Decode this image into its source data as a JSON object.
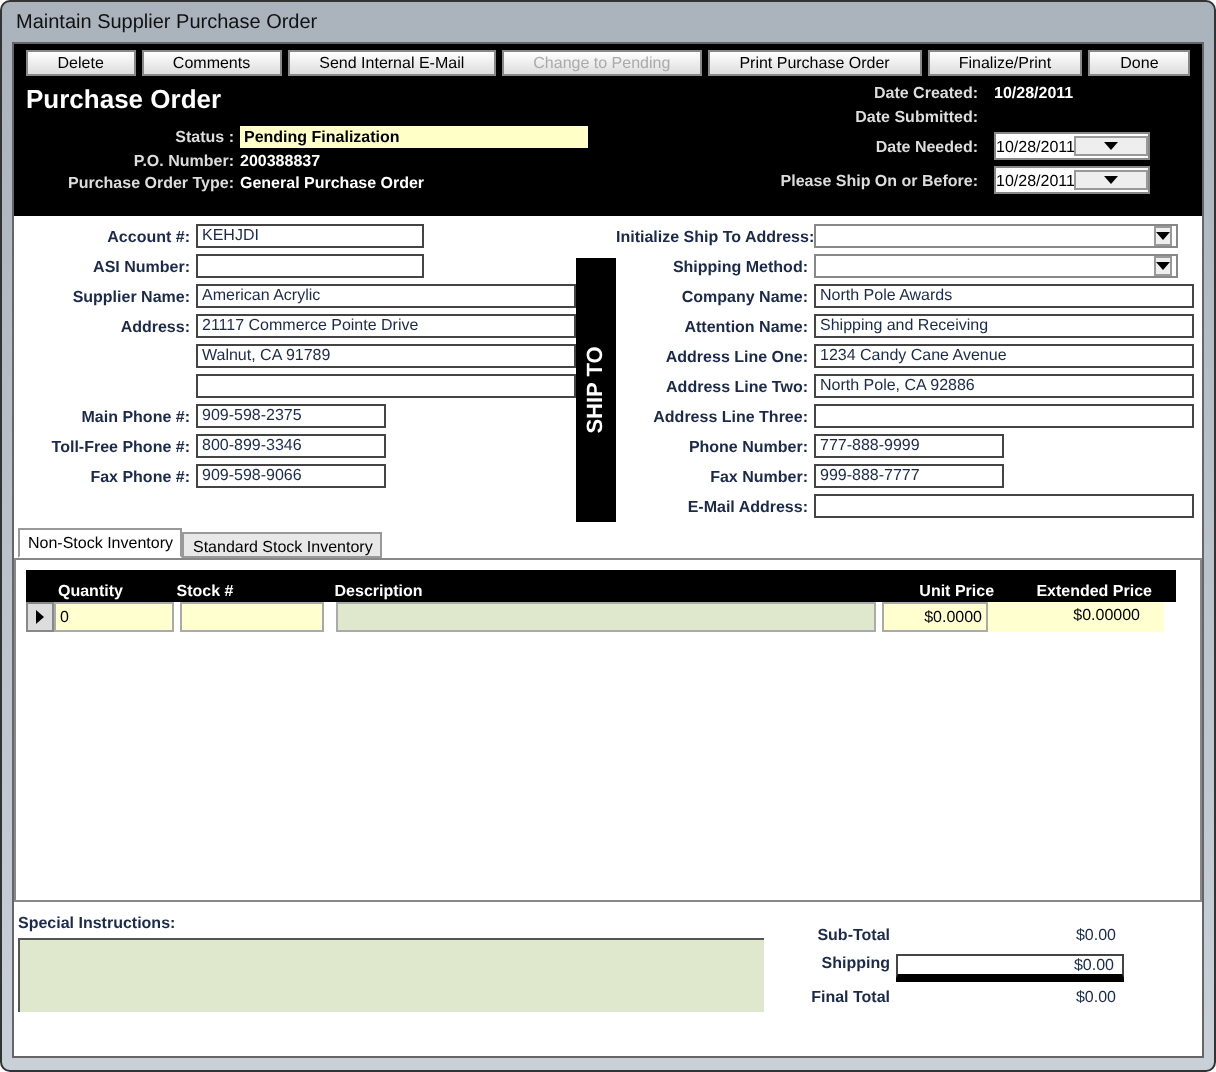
{
  "window": {
    "title": "Maintain Supplier Purchase Order"
  },
  "toolbar": [
    {
      "label": "Delete",
      "disabled": false
    },
    {
      "label": "Comments",
      "disabled": false
    },
    {
      "label": "Send Internal E-Mail",
      "disabled": false
    },
    {
      "label": "Change to Pending",
      "disabled": true
    },
    {
      "label": "Print Purchase Order",
      "disabled": false
    },
    {
      "label": "Finalize/Print",
      "disabled": false
    },
    {
      "label": "Done",
      "disabled": false
    }
  ],
  "header": {
    "title": "Purchase Order",
    "fields": [
      {
        "label": "Status :",
        "value": "Pending Finalization",
        "kind": "highlight"
      },
      {
        "label": "P.O. Number:",
        "value": "200388837",
        "kind": "plain"
      },
      {
        "label": "Purchase Order Type:",
        "value": "General Purchase Order",
        "kind": "plain"
      }
    ],
    "dates": [
      {
        "label": "Date Created:",
        "value": "10/28/2011",
        "kind": "plain"
      },
      {
        "label": "Date Submitted:",
        "kind": "plain"
      },
      {
        "label": "Date Needed:",
        "value": "10/28/2011",
        "kind": "dropdown"
      },
      {
        "label": "Please Ship On or Before:",
        "value": "10/28/2011",
        "kind": "dropdown"
      }
    ]
  },
  "supplier": {
    "fields": [
      {
        "label": "Account #:",
        "value": "KEHJDI",
        "kind": "medium"
      },
      {
        "label": "ASI Number:",
        "kind": "medium"
      },
      {
        "label": "Supplier Name:",
        "value": "American Acrylic",
        "kind": "long"
      },
      {
        "label": "Address:",
        "value": "21117 Commerce Pointe Drive",
        "kind": "long"
      },
      {
        "value": "Walnut, CA 91789",
        "kind": "long"
      },
      {
        "kind": "long"
      },
      {
        "label": "Main Phone #:",
        "value": "909-598-2375",
        "kind": "short"
      },
      {
        "label": "Toll-Free Phone #:",
        "value": "800-899-3346",
        "kind": "short"
      },
      {
        "label": "Fax Phone #:",
        "value": "909-598-9066",
        "kind": "short"
      }
    ]
  },
  "ship_to": {
    "banner": "SHIP TO",
    "fields": [
      {
        "label": "Initialize Ship To Address:",
        "kind": "dropdown"
      },
      {
        "label": "Shipping Method:",
        "kind": "dropdown"
      },
      {
        "label": "Company Name:",
        "value": "North Pole Awards",
        "kind": "long"
      },
      {
        "label": "Attention Name:",
        "value": "Shipping and Receiving",
        "kind": "long"
      },
      {
        "label": "Address Line One:",
        "value": "1234 Candy Cane Avenue",
        "kind": "long"
      },
      {
        "label": "Address Line Two:",
        "value": "North Pole, CA  92886",
        "kind": "long"
      },
      {
        "label": "Address Line Three:",
        "kind": "long"
      },
      {
        "label": "Phone Number:",
        "value": "777-888-9999",
        "kind": "short"
      },
      {
        "label": "Fax Number:",
        "value": "999-888-7777",
        "kind": "short"
      },
      {
        "label": "E-Mail Address:",
        "kind": "long"
      }
    ]
  },
  "tabs": [
    {
      "label": "Non-Stock Inventory",
      "selected": true
    },
    {
      "label": "Standard Stock Inventory",
      "selected": false
    }
  ],
  "grid": {
    "columns": [
      "Quantity",
      "Stock #",
      "Description",
      "Unit Price",
      "Extended Price"
    ],
    "rows": [
      {
        "quantity": "0",
        "unit_price": "$0.0000",
        "extended_price": "$0.00000"
      }
    ]
  },
  "special_instructions": {
    "label": "Special Instructions:"
  },
  "totals": [
    {
      "label": "Sub-Total",
      "value": "$0.00",
      "kind": "plain"
    },
    {
      "label": "Shipping",
      "value": "$0.00",
      "kind": "boxed"
    },
    {
      "label": "Final Total",
      "value": "$0.00",
      "kind": "plain"
    }
  ]
}
